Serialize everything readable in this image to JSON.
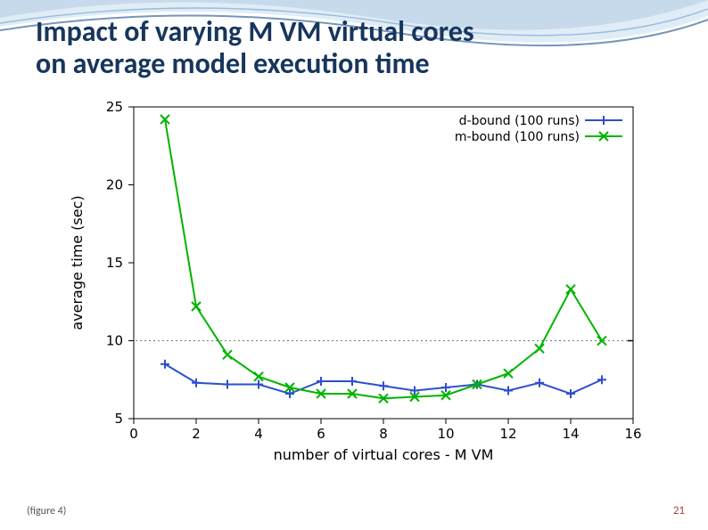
{
  "slide": {
    "title_line1": "Impact of varying M VM virtual cores",
    "title_line2": "on average model execution time",
    "figure_caption": "(figure 4)",
    "page_number": "21"
  },
  "chart_data": {
    "type": "line",
    "title": "",
    "xlabel": "number of virtual cores - M VM",
    "ylabel": "average time (sec)",
    "xlim": [
      0,
      16
    ],
    "ylim": [
      5,
      25
    ],
    "xticks": [
      0,
      2,
      4,
      6,
      8,
      10,
      12,
      14,
      16
    ],
    "yticks": [
      5,
      10,
      15,
      20,
      25
    ],
    "hline": 10,
    "legend_position": "top-right",
    "series": [
      {
        "name": "d-bound (100 runs)",
        "color": "#2e4fd1",
        "marker": "plus",
        "x": [
          1,
          2,
          3,
          4,
          5,
          6,
          7,
          8,
          9,
          10,
          11,
          12,
          13,
          14,
          15
        ],
        "y": [
          8.5,
          7.3,
          7.2,
          7.2,
          6.6,
          7.4,
          7.4,
          7.1,
          6.8,
          7.0,
          7.2,
          6.8,
          7.3,
          6.6,
          7.5
        ]
      },
      {
        "name": "m-bound (100 runs)",
        "color": "#00b400",
        "marker": "x",
        "x": [
          1,
          2,
          3,
          4,
          5,
          6,
          7,
          8,
          9,
          10,
          11,
          12,
          13,
          14,
          15
        ],
        "y": [
          24.2,
          12.2,
          9.1,
          7.7,
          7.0,
          6.6,
          6.6,
          6.3,
          6.4,
          6.5,
          7.2,
          7.9,
          9.5,
          13.3,
          10.0
        ]
      }
    ]
  }
}
